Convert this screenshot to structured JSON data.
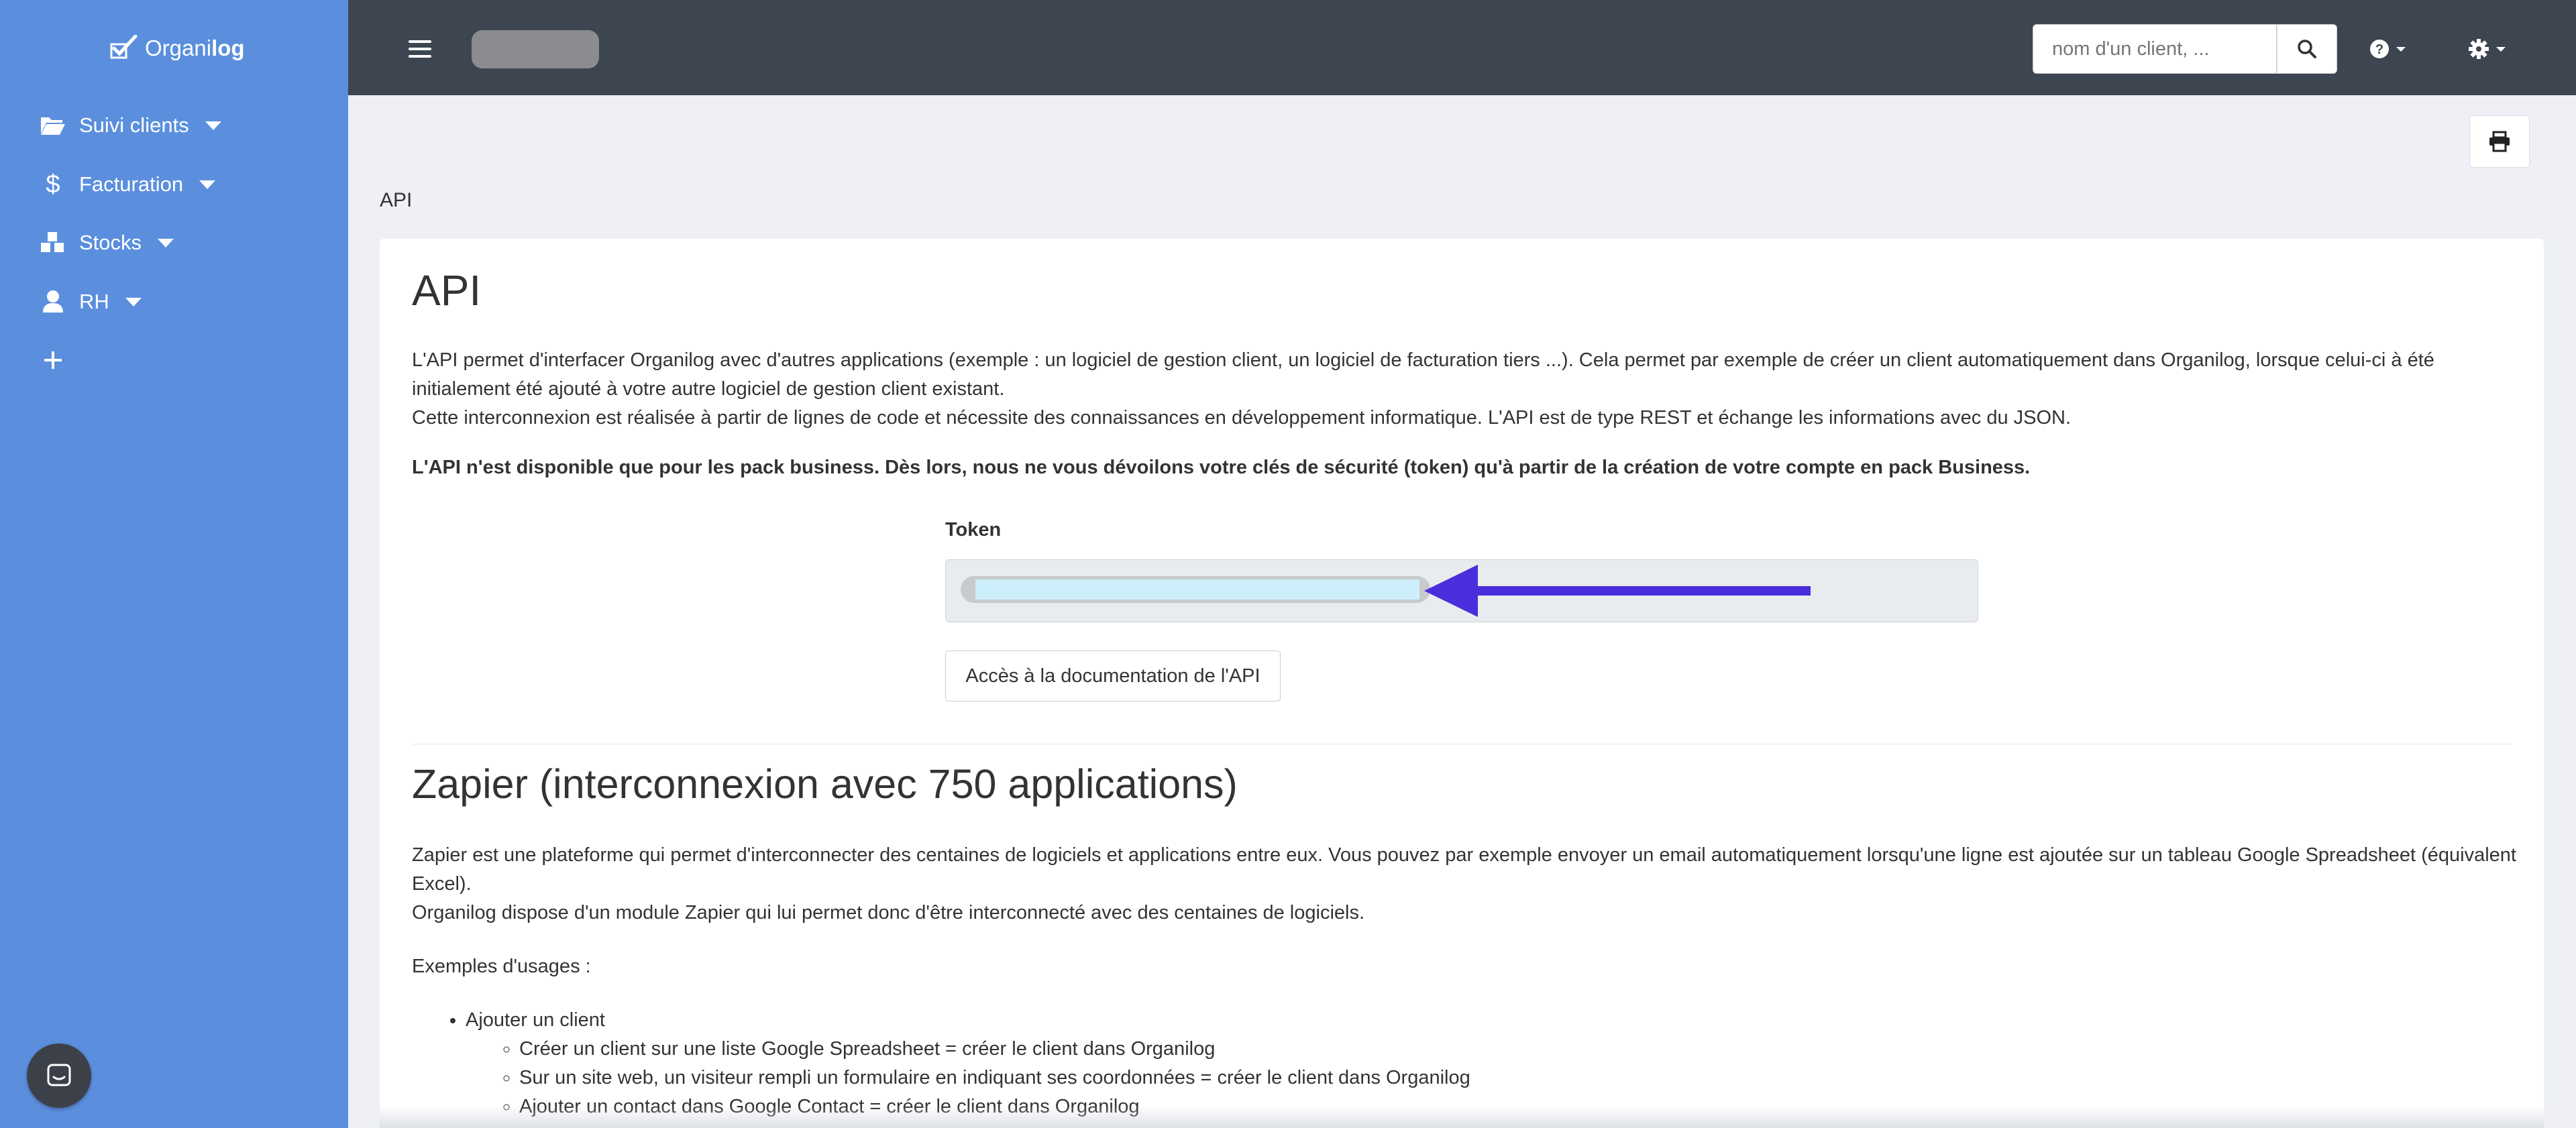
{
  "sidebar": {
    "logo_prefix": "Organi",
    "logo_suffix": "log",
    "items": [
      {
        "label": "Suivi clients",
        "icon": "folder-open-icon"
      },
      {
        "label": "Facturation",
        "icon": "dollar-icon"
      },
      {
        "label": "Stocks",
        "icon": "cubes-icon"
      },
      {
        "label": "RH",
        "icon": "user-icon"
      }
    ],
    "add_icon": "plus-icon",
    "chat_icon": "chat-icon"
  },
  "topbar": {
    "search_placeholder": "nom d'un client, ...",
    "search_icon": "search-icon",
    "help_icon": "question-circle-icon",
    "settings_icon": "gear-icon"
  },
  "breadcrumb": "API",
  "api": {
    "title": "API",
    "intro_line1": "L'API permet d'interfacer Organilog avec d'autres applications (exemple : un logiciel de gestion client, un logiciel de facturation tiers ...). Cela permet par exemple de créer un client automatiquement dans Organilog, lorsque celui-ci à été initialement été ajouté à votre autre logiciel de gestion client existant.",
    "intro_line2": "Cette interconnexion est réalisée à partir de lignes de code et nécessite des connaissances en développement informatique. L'API est de type REST et échange les informations avec du JSON.",
    "notice": "L'API n'est disponible que pour les pack business. Dès lors, nous ne vous dévoilons votre clés de sécurité (token) qu'à partir de la création de votre compte en pack Business.",
    "token_label": "Token",
    "doc_button": "Accès à la documentation de l'API",
    "arrow_color": "#4a2ddb"
  },
  "zapier": {
    "title": "Zapier (interconnexion avec 750 applications)",
    "intro_line1": "Zapier est une plateforme qui permet d'interconnecter des centaines de logiciels et applications entre eux. Vous pouvez par exemple envoyer un email automatiquement lorsqu'une ligne est ajoutée sur un tableau Google Spreadsheet (équivalent Excel).",
    "intro_line2": "Organilog dispose d'un module Zapier qui lui permet donc d'être interconnecté avec des centaines de logiciels.",
    "examples_label": "Exemples d'usages :",
    "examples": [
      {
        "label": "Ajouter un client",
        "sub": [
          "Créer un client sur une liste Google Spreadsheet = créer le client dans Organilog",
          "Sur un site web, un visiteur rempli un formulaire en indiquant ses coordonnées = créer le client dans Organilog",
          "Ajouter un contact dans Google Contact = créer le client dans Organilog"
        ]
      }
    ]
  },
  "colors": {
    "sidebar": "#5b8fde",
    "topbar": "#3c4550",
    "background": "#eef0f5"
  }
}
